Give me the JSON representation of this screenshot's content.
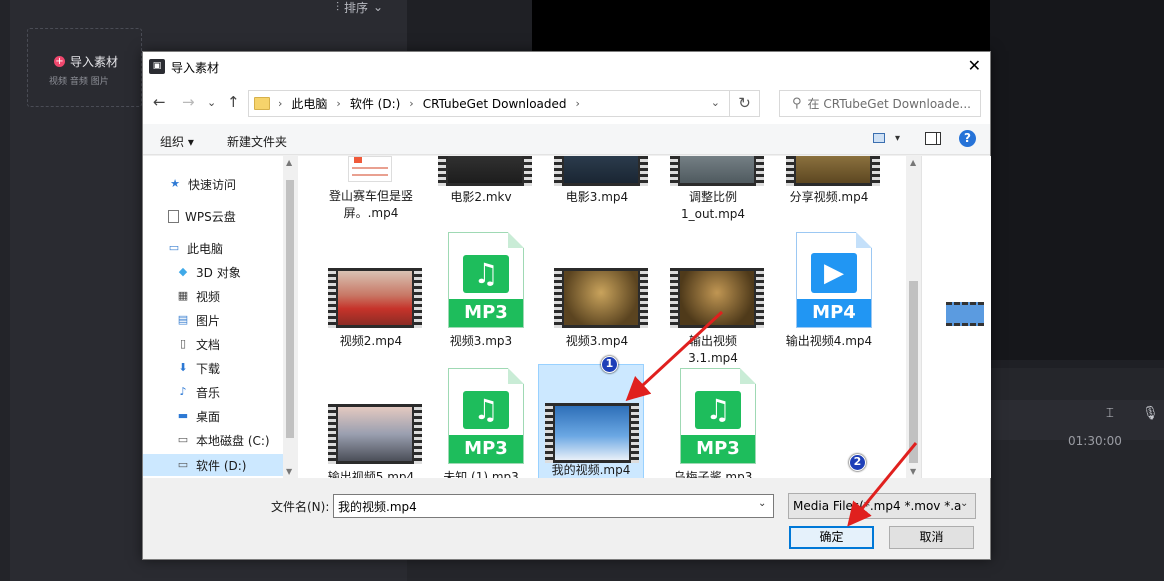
{
  "app": {
    "sort_label": "排序",
    "import_title": "导入素材",
    "import_sub": "视频 音频 图片",
    "timeline_time": "01:30:00"
  },
  "dialog": {
    "title": "导入素材",
    "breadcrumbs": [
      "此电脑",
      "软件 (D:)",
      "CRTubeGet Downloaded"
    ],
    "search_placeholder": "在 CRTubeGet Downloade...",
    "toolbar": {
      "organize": "组织 ▾",
      "new_folder": "新建文件夹"
    },
    "nav": [
      {
        "label": "快速访问",
        "icon": "star-icon"
      },
      {
        "label": "WPS云盘",
        "icon": "cloud-doc-icon"
      },
      {
        "label": "此电脑",
        "icon": "computer-icon"
      },
      {
        "label": "3D 对象",
        "icon": "cube-icon"
      },
      {
        "label": "视频",
        "icon": "film-icon"
      },
      {
        "label": "图片",
        "icon": "picture-icon"
      },
      {
        "label": "文档",
        "icon": "document-icon"
      },
      {
        "label": "下载",
        "icon": "download-icon"
      },
      {
        "label": "音乐",
        "icon": "music-icon"
      },
      {
        "label": "桌面",
        "icon": "desktop-icon"
      },
      {
        "label": "本地磁盘 (C:)",
        "icon": "drive-icon"
      },
      {
        "label": "软件 (D:)",
        "icon": "drive-icon"
      }
    ],
    "files": [
      {
        "name": "登山赛车但是竖屏。.mp4",
        "kind": "video"
      },
      {
        "name": "电影2.mkv",
        "kind": "video"
      },
      {
        "name": "电影3.mp4",
        "kind": "video"
      },
      {
        "name": "调整比例1_out.mp4",
        "kind": "video"
      },
      {
        "name": "分享视频.mp4",
        "kind": "video"
      },
      {
        "name": "视频2.mp4",
        "kind": "video"
      },
      {
        "name": "视频3.mp3",
        "kind": "audio"
      },
      {
        "name": "视频3.mp4",
        "kind": "video"
      },
      {
        "name": "输出视频3.1.mp4",
        "kind": "video"
      },
      {
        "name": "输出视频4.mp4",
        "kind": "mp4-icon"
      },
      {
        "name": "输出视频5.mp4",
        "kind": "video"
      },
      {
        "name": "未知 (1).mp3",
        "kind": "audio"
      },
      {
        "name": "我的视频.mp4",
        "kind": "video",
        "selected": true
      },
      {
        "name": "乌梅子酱.mp3",
        "kind": "audio"
      }
    ],
    "file_type_label": "MP3",
    "mp4_type_label": "MP4",
    "filename_label": "文件名(N):",
    "filename_value": "我的视频.mp4",
    "filter_value": "Media Files(*.mp4 *.mov *.a",
    "ok_label": "确定",
    "cancel_label": "取消"
  },
  "annotations": {
    "marker1": "1",
    "marker2": "2",
    "color": "#e0201e"
  }
}
